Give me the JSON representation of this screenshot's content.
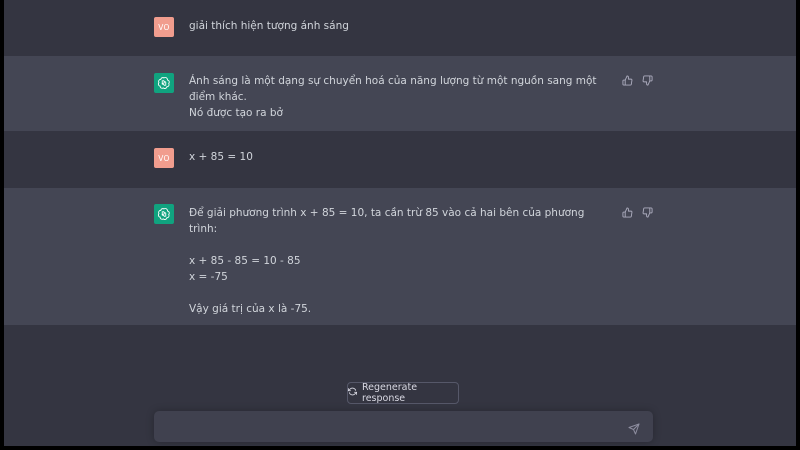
{
  "conversation": {
    "turn1": {
      "user_initials": "VO",
      "text": "giải thích hiện tượng ánh sáng"
    },
    "turn2": {
      "line1": "Ánh sáng là một dạng sự chuyển hoá của năng lượng từ một nguồn sang một điểm khác.",
      "line2": "Nó được tạo ra bở"
    },
    "turn3": {
      "user_initials": "VO",
      "text": "x + 85 = 10"
    },
    "turn4": {
      "line1": "Để giải phương trình x + 85 = 10, ta cần trừ 85 vào cả hai bên của phương trình:",
      "line2": "x + 85 - 85 = 10 - 85",
      "line3": "x = -75",
      "line4": "Vậy giá trị của x là -75."
    }
  },
  "regenerate_label": "Regenerate response",
  "composer": {
    "value": ""
  },
  "icons": {
    "user_avatar": "user-avatar",
    "bot_avatar": "openai-logo-icon",
    "like": "thumbs-up-icon",
    "dislike": "thumbs-down-icon",
    "regenerate": "refresh-icon",
    "send": "send-icon"
  },
  "colors": {
    "background": "#343541",
    "assistant_row": "#444654",
    "user_avatar": "#f19d8e",
    "bot_avatar": "#10a37f",
    "text": "#d1d5db"
  }
}
